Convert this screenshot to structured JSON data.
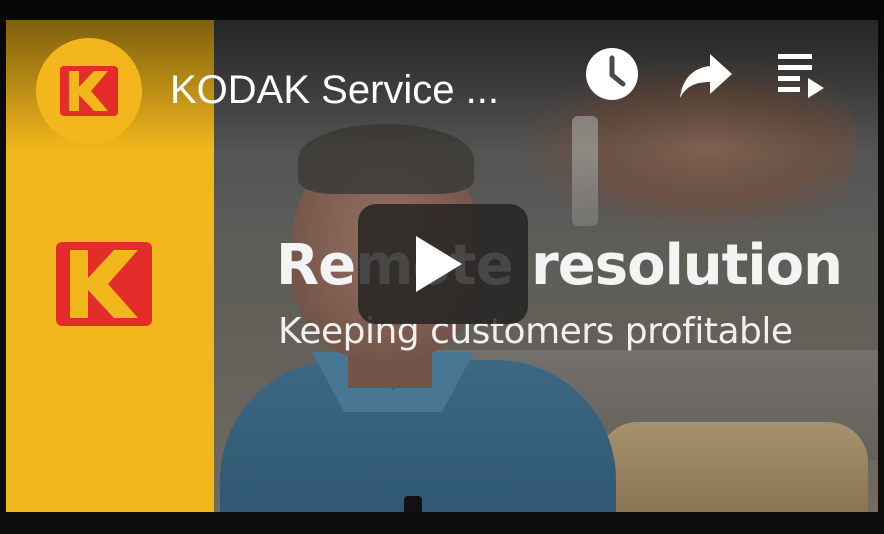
{
  "player": {
    "title": "KODAK Service ...",
    "overlay": {
      "headline": "Remote resolution",
      "subline": "Keeping customers profitable"
    },
    "icons": {
      "channel_logo": "kodak-logo-icon",
      "watch_later": "clock-icon",
      "share": "share-icon",
      "playlist": "playlist-icon",
      "play": "play-icon"
    },
    "colors": {
      "brand_yellow": "#f2b71c",
      "brand_red": "#e42c2a"
    }
  }
}
